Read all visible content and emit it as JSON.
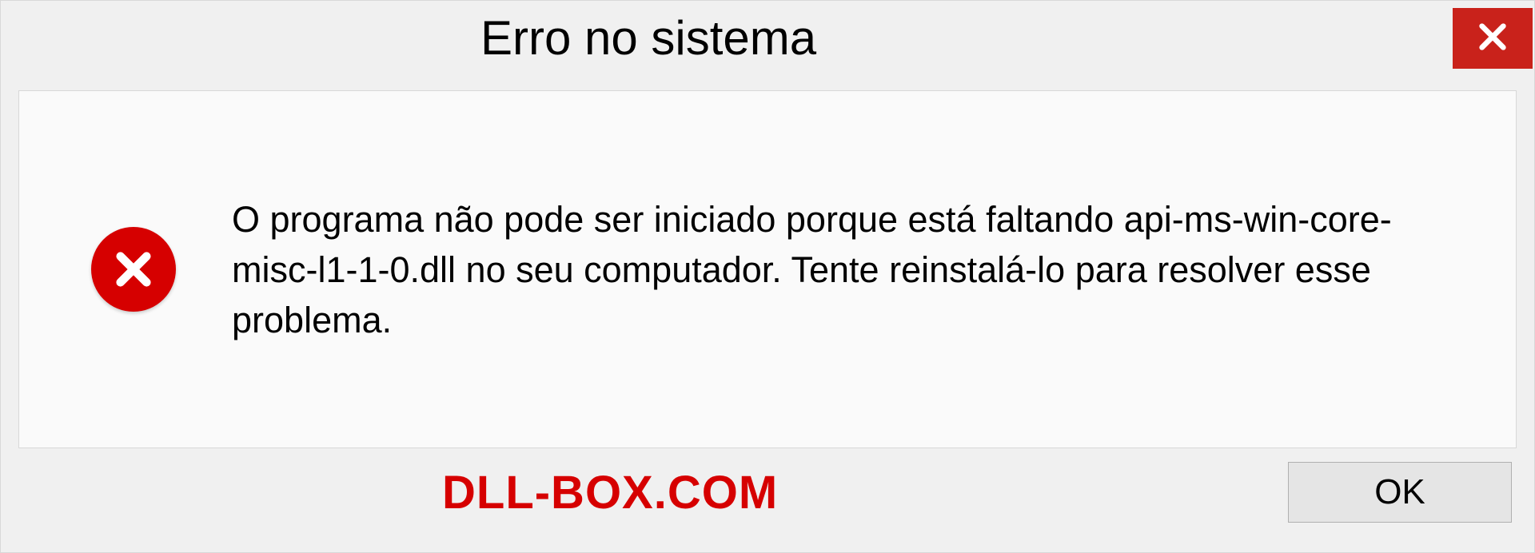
{
  "dialog": {
    "title": "Erro no sistema",
    "message": "O programa não pode ser iniciado porque está faltando api-ms-win-core-misc-l1-1-0.dll no seu computador. Tente reinstalá-lo para resolver esse problema.",
    "ok_label": "OK"
  },
  "watermark": "DLL-BOX.COM"
}
